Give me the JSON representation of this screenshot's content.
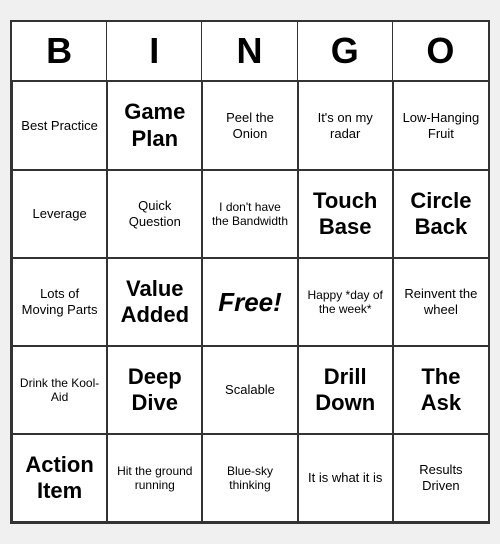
{
  "header": {
    "letters": [
      "B",
      "I",
      "N",
      "G",
      "O"
    ]
  },
  "cells": [
    {
      "text": "Best Practice",
      "size": "small"
    },
    {
      "text": "Game Plan",
      "size": "large"
    },
    {
      "text": "Peel the Onion",
      "size": "small"
    },
    {
      "text": "It's on my radar",
      "size": "small"
    },
    {
      "text": "Low-Hanging Fruit",
      "size": "small"
    },
    {
      "text": "Leverage",
      "size": "small"
    },
    {
      "text": "Quick Question",
      "size": "small"
    },
    {
      "text": "I don't have the Bandwidth",
      "size": "xsmall"
    },
    {
      "text": "Touch Base",
      "size": "large"
    },
    {
      "text": "Circle Back",
      "size": "large"
    },
    {
      "text": "Lots of Moving Parts",
      "size": "small"
    },
    {
      "text": "Value Added",
      "size": "large"
    },
    {
      "text": "Free!",
      "size": "free"
    },
    {
      "text": "Happy *day of the week*",
      "size": "xsmall"
    },
    {
      "text": "Reinvent the wheel",
      "size": "small"
    },
    {
      "text": "Drink the Kool-Aid",
      "size": "xsmall"
    },
    {
      "text": "Deep Dive",
      "size": "large"
    },
    {
      "text": "Scalable",
      "size": "small"
    },
    {
      "text": "Drill Down",
      "size": "large"
    },
    {
      "text": "The Ask",
      "size": "large"
    },
    {
      "text": "Action Item",
      "size": "large"
    },
    {
      "text": "Hit the ground running",
      "size": "xsmall"
    },
    {
      "text": "Blue-sky thinking",
      "size": "xsmall"
    },
    {
      "text": "It is what it is",
      "size": "small"
    },
    {
      "text": "Results Driven",
      "size": "small"
    }
  ]
}
